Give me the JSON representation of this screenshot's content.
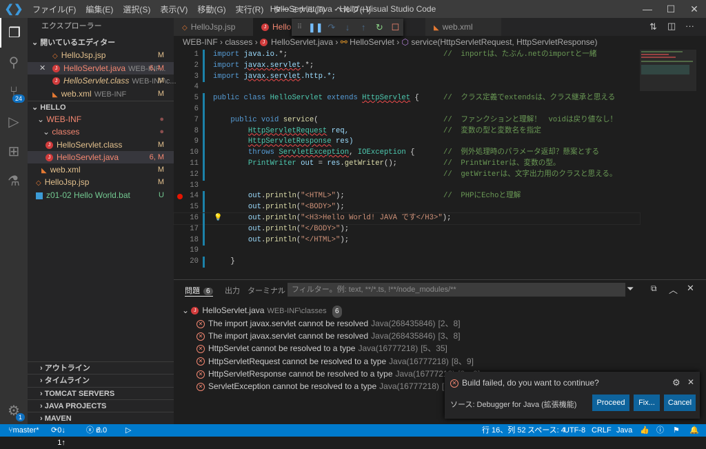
{
  "titlebar": {
    "menus": [
      "ファイル(F)",
      "編集(E)",
      "選択(S)",
      "表示(V)",
      "移動(G)",
      "実行(R)",
      "ターミナル(T)",
      "ヘルプ(H)"
    ],
    "title": "HelloServlet.java - Hello - Visual Studio Code"
  },
  "activity": {
    "scm_badge": "24",
    "settings_badge": "1"
  },
  "sidebar": {
    "title": "エクスプローラー",
    "open_editors": "開いているエディター",
    "open_items": [
      {
        "name": "HelloJsp.jsp",
        "desc": "",
        "status": "M",
        "icon": "jsp"
      },
      {
        "name": "HelloServlet.java",
        "desc": "WEB-INF...",
        "status": "6, M",
        "icon": "java"
      },
      {
        "name": "HelloServlet.class",
        "desc": "WEB-INF\\c...",
        "status": "M",
        "icon": "java"
      },
      {
        "name": "web.xml",
        "desc": "WEB-INF",
        "status": "M",
        "icon": "xml"
      }
    ],
    "folder": "HELLO",
    "tree": [
      {
        "name": "WEB-INF",
        "status": "●",
        "icon": "folder"
      },
      {
        "name": "classes",
        "status": "●",
        "icon": "folder"
      },
      {
        "name": "HelloServlet.class",
        "status": "M",
        "icon": "java"
      },
      {
        "name": "HelloServlet.java",
        "status": "6, M",
        "icon": "java"
      },
      {
        "name": "web.xml",
        "status": "M",
        "icon": "xml"
      },
      {
        "name": "HelloJsp.jsp",
        "status": "M",
        "icon": "jsp"
      },
      {
        "name": "z01-02 Hello World.bat",
        "status": "U",
        "icon": "bat"
      }
    ],
    "sections": [
      "アウトライン",
      "タイムライン",
      "TOMCAT SERVERS",
      "JAVA PROJECTS",
      "MAVEN"
    ]
  },
  "tabs": [
    "HelloJsp.jsp",
    "HelloServlet.java",
    "web.xml"
  ],
  "breadcrumb": [
    "WEB-INF",
    "classes",
    "HelloServlet.java",
    "HelloServlet",
    "service(HttpServletRequest, HttpServletResponse)"
  ],
  "code": [
    {
      "t": [
        [
          "import ",
          "kw"
        ],
        [
          "java.io.",
          "va"
        ],
        [
          "*;",
          "pl"
        ]
      ],
      "c": "//  inportは、たぶん.netのimportと一緒"
    },
    {
      "t": [
        [
          "import ",
          "kw"
        ],
        [
          "javax.servlet",
          "va sq"
        ],
        [
          ".*;",
          "pl"
        ]
      ],
      "c": ""
    },
    {
      "t": [
        [
          "import ",
          "kw"
        ],
        [
          "javax.servlet",
          "va sq"
        ],
        [
          ".http.*;",
          "va"
        ]
      ],
      "c": ""
    },
    {
      "t": [],
      "c": ""
    },
    {
      "t": [
        [
          "public class ",
          "kw"
        ],
        [
          "HelloServlet ",
          "ty"
        ],
        [
          "extends ",
          "kw"
        ],
        [
          "HttpServlet",
          "ty sq"
        ],
        [
          " {",
          "pl"
        ]
      ],
      "c": "//  クラス定義でextendsは、クラス継承と思える"
    },
    {
      "t": [],
      "c": ""
    },
    {
      "t": [
        [
          "    public void ",
          "kw"
        ],
        [
          "service",
          "fn"
        ],
        [
          "(",
          "pl"
        ]
      ],
      "c": "//  ファンクションと理解！　voidは戻り値なし！"
    },
    {
      "t": [
        [
          "        ",
          "pl"
        ],
        [
          "HttpServletRequest",
          "ty sq"
        ],
        [
          " req,",
          "va"
        ]
      ],
      "c": "//  変数の型と変数名を指定"
    },
    {
      "t": [
        [
          "        ",
          "pl"
        ],
        [
          "HttpServletResponse",
          "ty sq"
        ],
        [
          " res)",
          "va"
        ]
      ],
      "c": ""
    },
    {
      "t": [
        [
          "        throws ",
          "kw"
        ],
        [
          "ServletException",
          "ty sq"
        ],
        [
          ", ",
          "pl"
        ],
        [
          "IOException",
          "ty"
        ],
        [
          " {",
          "pl"
        ]
      ],
      "c": "//  例外処理時のパラメータ返却？懸案とする"
    },
    {
      "t": [
        [
          "        ",
          "pl"
        ],
        [
          "PrintWriter ",
          "ty"
        ],
        [
          "out",
          "va"
        ],
        [
          " = ",
          "pl"
        ],
        [
          "res",
          "va"
        ],
        [
          ".",
          "pl"
        ],
        [
          "getWriter",
          "fn"
        ],
        [
          "();",
          "pl"
        ]
      ],
      "c": "//  PrintWriterは、変数の型。"
    },
    {
      "t": [],
      "c": "//  getWriterは、文字出力用のクラスと思える。"
    },
    {
      "t": [],
      "c": ""
    },
    {
      "t": [
        [
          "        ",
          "pl"
        ],
        [
          "out",
          "va"
        ],
        [
          ".",
          "pl"
        ],
        [
          "println",
          "fn"
        ],
        [
          "(",
          "pl"
        ],
        [
          "\"<HTML>\"",
          "st2"
        ],
        [
          ");",
          "pl"
        ]
      ],
      "c": "//  PHPにEchoと理解"
    },
    {
      "t": [
        [
          "        ",
          "pl"
        ],
        [
          "out",
          "va"
        ],
        [
          ".",
          "pl"
        ],
        [
          "println",
          "fn"
        ],
        [
          "(",
          "pl"
        ],
        [
          "\"<BODY>\"",
          "st2"
        ],
        [
          ");",
          "pl"
        ]
      ],
      "c": ""
    },
    {
      "t": [
        [
          "        ",
          "pl"
        ],
        [
          "out",
          "va"
        ],
        [
          ".",
          "pl"
        ],
        [
          "println",
          "fn"
        ],
        [
          "(",
          "pl"
        ],
        [
          "\"<H3>Hello World! JAVA です</H3>\"",
          "st2"
        ],
        [
          ");",
          "pl"
        ]
      ],
      "c": ""
    },
    {
      "t": [
        [
          "        ",
          "pl"
        ],
        [
          "out",
          "va"
        ],
        [
          ".",
          "pl"
        ],
        [
          "println",
          "fn"
        ],
        [
          "(",
          "pl"
        ],
        [
          "\"</BODY>\"",
          "st2"
        ],
        [
          ");",
          "pl"
        ]
      ],
      "c": ""
    },
    {
      "t": [
        [
          "        ",
          "pl"
        ],
        [
          "out",
          "va"
        ],
        [
          ".",
          "pl"
        ],
        [
          "println",
          "fn"
        ],
        [
          "(",
          "pl"
        ],
        [
          "\"</HTML>\"",
          "st2"
        ],
        [
          ");",
          "pl"
        ]
      ],
      "c": ""
    },
    {
      "t": [],
      "c": ""
    },
    {
      "t": [
        [
          "    }",
          "pl"
        ]
      ],
      "c": ""
    }
  ],
  "panel": {
    "tabs": [
      "問題",
      "出力",
      "ターミナル",
      "···"
    ],
    "problem_count": "6",
    "filter_placeholder": "フィルター。例: text, **/*.ts, !**/node_modules/**",
    "file": {
      "name": "HelloServlet.java",
      "path": "WEB-INF\\classes",
      "count": "6"
    },
    "problems": [
      {
        "msg": "The import javax.servlet cannot be resolved",
        "code": "Java(268435846)",
        "loc": "[2、8]"
      },
      {
        "msg": "The import javax.servlet cannot be resolved",
        "code": "Java(268435846)",
        "loc": "[3、8]"
      },
      {
        "msg": "HttpServlet cannot be resolved to a type",
        "code": "Java(16777218)",
        "loc": "[5、35]"
      },
      {
        "msg": "HttpServletRequest cannot be resolved to a type",
        "code": "Java(16777218)",
        "loc": "[8、9]"
      },
      {
        "msg": "HttpServletResponse cannot be resolved to a type",
        "code": "Java(16777218)",
        "loc": "[9、9]"
      },
      {
        "msg": "ServletException cannot be resolved to a type",
        "code": "Java(16777218)",
        "loc": "[10、16]"
      }
    ]
  },
  "notification": {
    "message": "Build failed, do you want to continue?",
    "source": "ソース: Debugger for Java (拡張機能)",
    "buttons": [
      "Proceed",
      "Fix...",
      "Cancel"
    ]
  },
  "status": {
    "branch": "master*",
    "sync": "0↓ 1↑",
    "errors": "6",
    "warnings": "0",
    "position": "行 16、列 52",
    "spaces": "スペース: 4",
    "encoding": "UTF-8",
    "eol": "CRLF",
    "language": "Java"
  },
  "colors": {
    "statusbar": "#007acc",
    "activity": "#333333",
    "sidebar": "#252526",
    "editor": "#1e1e1e",
    "error": "#f48771"
  }
}
